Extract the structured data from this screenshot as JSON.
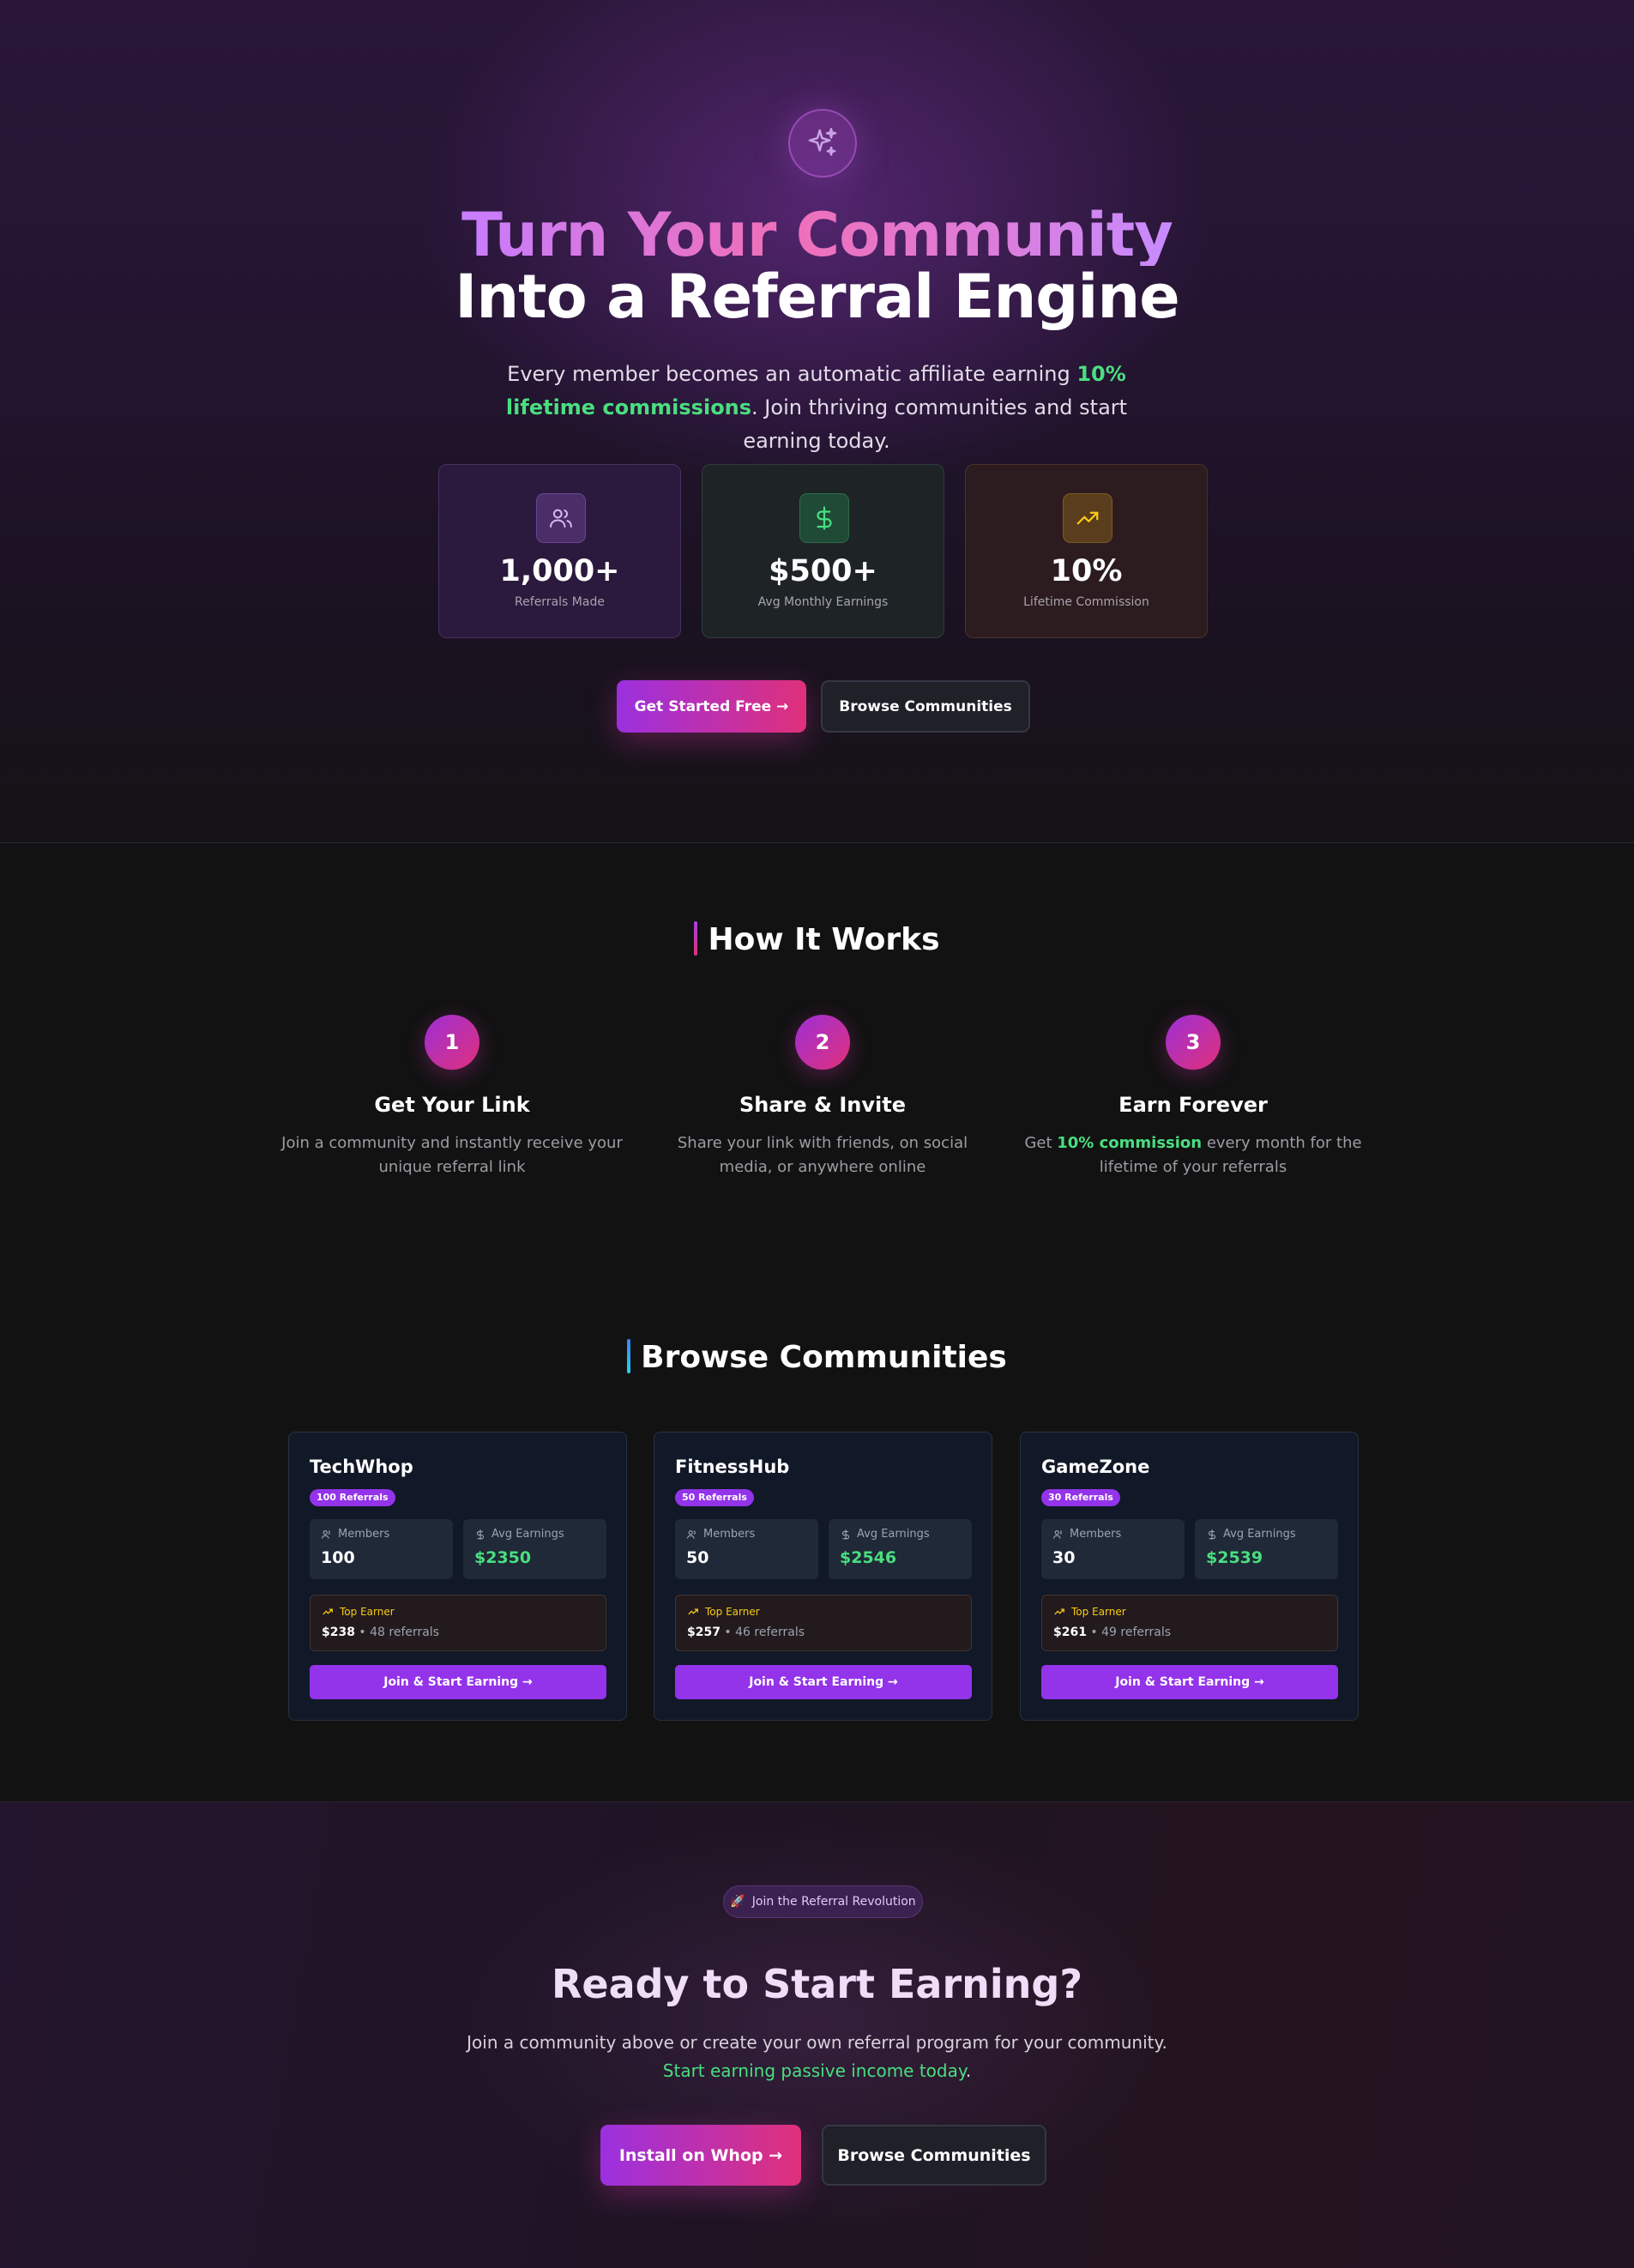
{
  "colors": {
    "accent_purple": "#9333ea",
    "accent_pink": "#e0307a",
    "green": "#4ade80",
    "gold": "#facc15",
    "background": "#121212"
  },
  "hero": {
    "icon": "sparkles-icon",
    "title_line1": "Turn Your Community",
    "title_line2": "Into a Referral Engine",
    "subtitle_pre": "Every member becomes an automatic affiliate earning ",
    "subtitle_highlight": "10% lifetime commissions",
    "subtitle_post": ". Join thriving communities and start earning today.",
    "stats": [
      {
        "icon": "users-icon",
        "value": "1,000+",
        "label": "Referrals Made"
      },
      {
        "icon": "dollar-icon",
        "value": "$500+",
        "label": "Avg Monthly Earnings"
      },
      {
        "icon": "trending-up-icon",
        "value": "10%",
        "label": "Lifetime Commission"
      }
    ],
    "primary_button": "Get Started Free →",
    "secondary_button": "Browse Communities"
  },
  "how_it_works": {
    "title": "How It Works",
    "steps": [
      {
        "number": "1",
        "title": "Get Your Link",
        "description": "Join a community and instantly receive your unique referral link"
      },
      {
        "number": "2",
        "title": "Share & Invite",
        "description": "Share your link with friends, on social media, or anywhere online"
      },
      {
        "number": "3",
        "title": "Earn Forever",
        "description_pre": "Get ",
        "description_highlight": "10% commission",
        "description_post": " every month for the lifetime of your referrals"
      }
    ]
  },
  "communities": {
    "title": "Browse Communities",
    "members_label": "Members",
    "avg_earnings_label": "Avg Earnings",
    "top_earner_label": "Top Earner",
    "join_label": "Join & Start Earning →",
    "items": [
      {
        "name": "TechWhop",
        "badge": "100 Referrals",
        "members": "100",
        "avg_earnings": "$2350",
        "top_amount": "$238",
        "top_referrals": "48 referrals"
      },
      {
        "name": "FitnessHub",
        "badge": "50 Referrals",
        "members": "50",
        "avg_earnings": "$2546",
        "top_amount": "$257",
        "top_referrals": "46 referrals"
      },
      {
        "name": "GameZone",
        "badge": "30 Referrals",
        "members": "30",
        "avg_earnings": "$2539",
        "top_amount": "$261",
        "top_referrals": "49 referrals"
      }
    ]
  },
  "cta": {
    "pill": "Join the Referral Revolution",
    "pill_icon": "rocket-icon",
    "title": "Ready to Start Earning?",
    "subtitle_line1": "Join a community above or create your own referral program for your community.",
    "subtitle_line2": "Start earning passive income today",
    "subtitle_line2_end": ".",
    "primary_button": "Install on Whop →",
    "secondary_button": "Browse Communities"
  }
}
